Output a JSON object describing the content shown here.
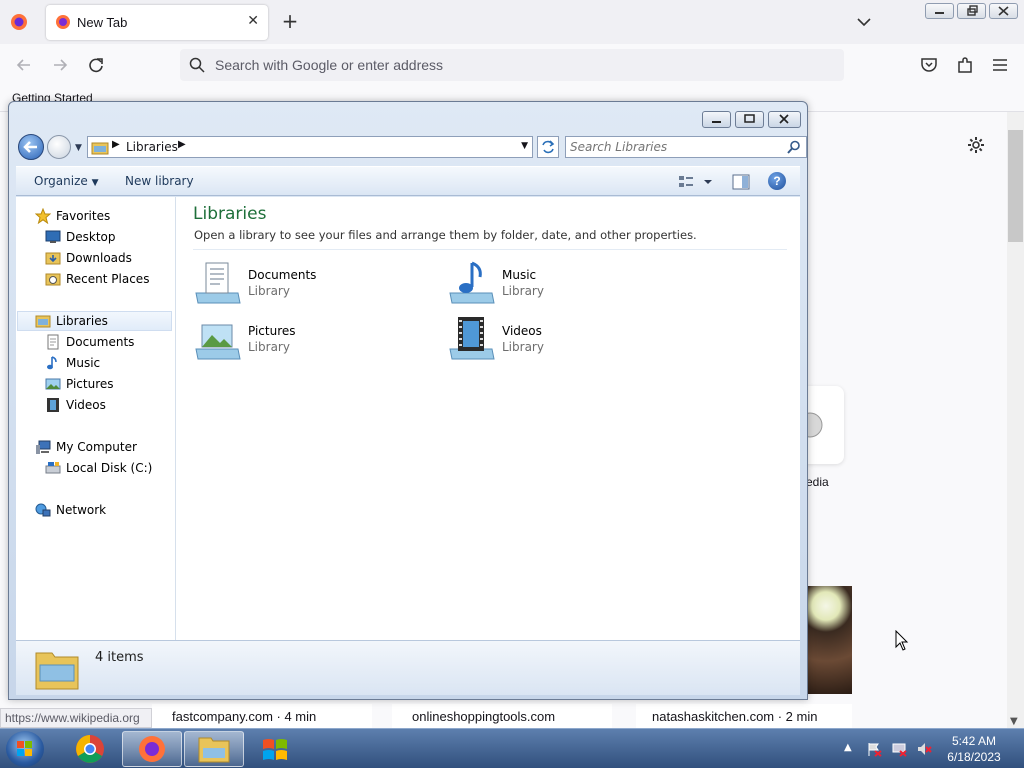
{
  "firefox": {
    "tab_title": "New Tab",
    "url_placeholder": "Search with Google or enter address",
    "bookmark_item": "Getting Started",
    "shortcut_label": "edia",
    "status_url": "https://www.wikipedia.org",
    "stories": [
      "fastcompany.com · 4 min",
      "onlineshoppingtools.com",
      "natashaskitchen.com · 2 min"
    ]
  },
  "explorer": {
    "breadcrumb": "Libraries",
    "search_placeholder": "Search Libraries",
    "toolbar": {
      "organize": "Organize",
      "new_library": "New library",
      "help": "?"
    },
    "nav": {
      "favorites": "Favorites",
      "desktop": "Desktop",
      "downloads": "Downloads",
      "recent_places": "Recent Places",
      "libraries": "Libraries",
      "documents": "Documents",
      "music": "Music",
      "pictures": "Pictures",
      "videos": "Videos",
      "my_computer": "My Computer",
      "local_disk": "Local Disk (C:)",
      "network": "Network"
    },
    "content": {
      "title": "Libraries",
      "subtitle": "Open a library to see your files and arrange them by folder, date, and other properties.",
      "items": [
        {
          "name": "Documents",
          "type": "Library"
        },
        {
          "name": "Music",
          "type": "Library"
        },
        {
          "name": "Pictures",
          "type": "Library"
        },
        {
          "name": "Videos",
          "type": "Library"
        }
      ]
    },
    "details": {
      "count": "4 items"
    }
  },
  "taskbar": {
    "time": "5:42 AM",
    "date": "6/18/2023"
  },
  "colors": {
    "content_title": "#1e6f3a",
    "taskbar": "#31507d",
    "selection": "#e1ecf9"
  }
}
